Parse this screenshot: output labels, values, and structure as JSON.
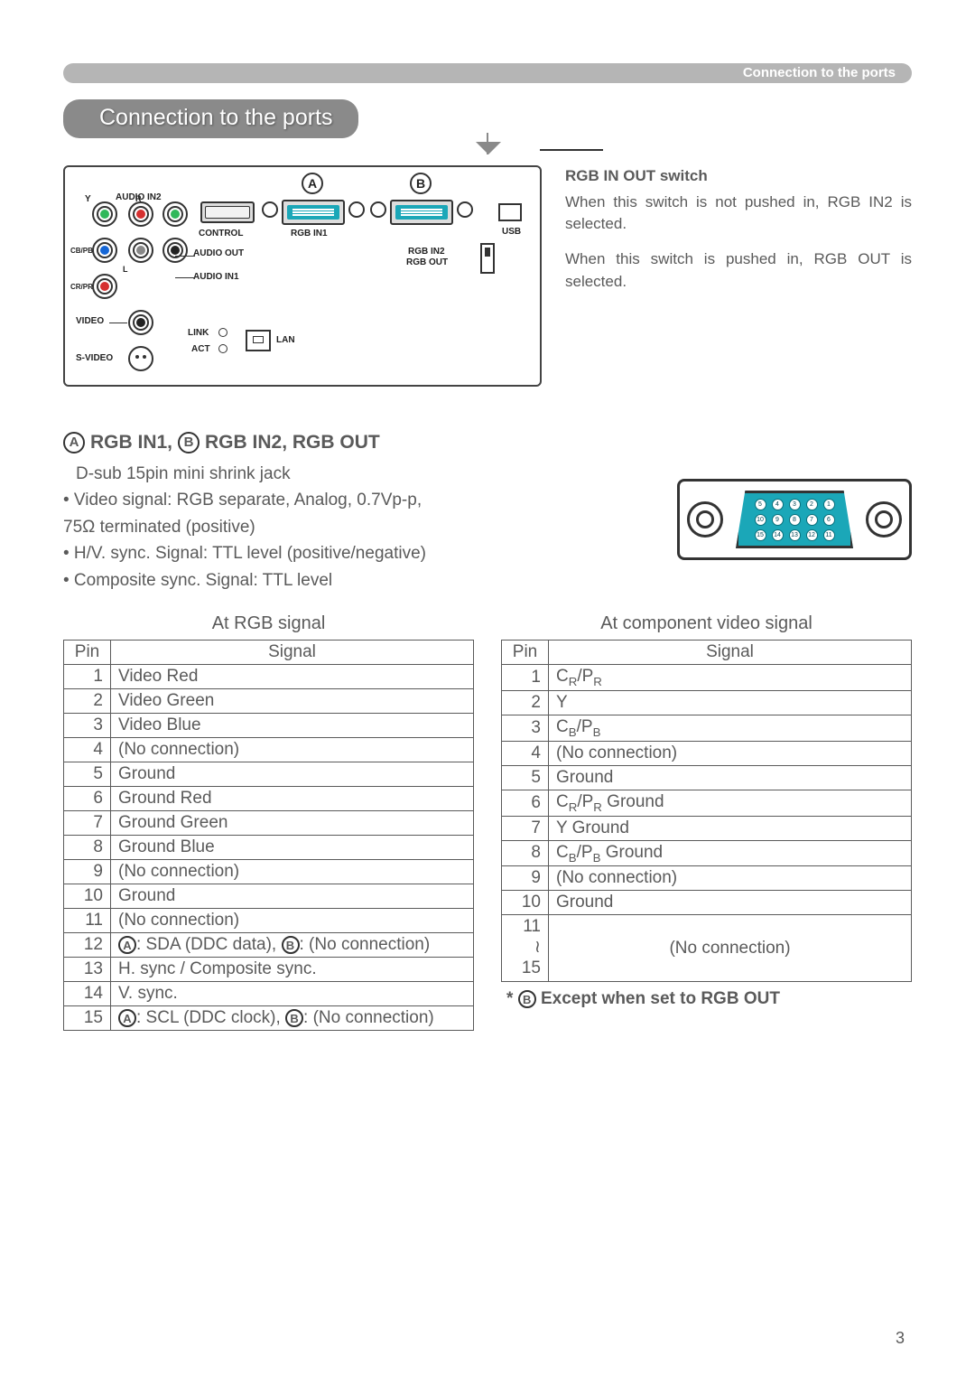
{
  "header": {
    "right_label": "Connection to the ports"
  },
  "title": "Connection to the ports",
  "diagram_labels": {
    "audio_in2": "AUDIO IN2",
    "y": "Y",
    "r": "R",
    "cb_pb": "CB/PB",
    "l": "L",
    "cr_pr": "CR/PR",
    "video": "VIDEO",
    "svideo": "S-VIDEO",
    "audio_out": "AUDIO OUT",
    "audio_in1": "AUDIO IN1",
    "control": "CONTROL",
    "rgb_in1": "RGB IN1",
    "rgb_in2": "RGB IN2",
    "rgb_out": "RGB OUT",
    "usb": "USB",
    "lan": "LAN",
    "link": "LINK",
    "act": "ACT",
    "callout_a": "A",
    "callout_b": "B"
  },
  "switch_text": {
    "title": "RGB IN OUT switch",
    "p1": "When this switch is not pushed in, RGB IN2 is selected.",
    "p2": "When this switch is pushed in, RGB OUT is selected."
  },
  "section_head": {
    "a": "A",
    "label_a": "RGB IN1,",
    "b": "B",
    "label_b": "RGB IN2, RGB OUT"
  },
  "specs": {
    "l1": "D-sub 15pin mini shrink jack",
    "l2": "• Video signal: RGB separate, Analog, 0.7Vp-p,",
    "l3": "75Ω terminated (positive)",
    "l4": "• H/V. sync. Signal: TTL level (positive/negative)",
    "l5": "• Composite sync. Signal: TTL level"
  },
  "tables": {
    "rgb": {
      "caption": "At RGB signal",
      "col1": "Pin",
      "col2": "Signal",
      "rows": [
        {
          "pin": "1",
          "signal": "Video Red"
        },
        {
          "pin": "2",
          "signal": "Video Green"
        },
        {
          "pin": "3",
          "signal": "Video Blue"
        },
        {
          "pin": "4",
          "signal": "(No connection)"
        },
        {
          "pin": "5",
          "signal": "Ground"
        },
        {
          "pin": "6",
          "signal": "Ground Red"
        },
        {
          "pin": "7",
          "signal": "Ground Green"
        },
        {
          "pin": "8",
          "signal": "Ground Blue"
        },
        {
          "pin": "9",
          "signal": "(No connection)"
        },
        {
          "pin": "10",
          "signal": "Ground"
        },
        {
          "pin": "11",
          "signal": "(No connection)"
        },
        {
          "pin": "12",
          "signal_pre": ": SDA (DDC data), ",
          "signal_post": ": (No connection)",
          "has_ab": true
        },
        {
          "pin": "13",
          "signal": "H. sync / Composite sync."
        },
        {
          "pin": "14",
          "signal": "V. sync."
        },
        {
          "pin": "15",
          "signal_pre": ": SCL (DDC clock), ",
          "signal_post": ": (No connection)",
          "has_ab": true
        }
      ]
    },
    "component": {
      "caption": "At component video signal",
      "col1": "Pin",
      "col2": "Signal",
      "rows": [
        {
          "pin": "1",
          "signal_html": "crpr"
        },
        {
          "pin": "2",
          "signal": "Y"
        },
        {
          "pin": "3",
          "signal_html": "cbpb"
        },
        {
          "pin": "4",
          "signal": "(No connection)"
        },
        {
          "pin": "5",
          "signal": "Ground"
        },
        {
          "pin": "6",
          "signal_html": "crpr_ground"
        },
        {
          "pin": "7",
          "signal": "Y Ground"
        },
        {
          "pin": "8",
          "signal_html": "cbpb_ground"
        },
        {
          "pin": "9",
          "signal": "(No connection)"
        },
        {
          "pin": "10",
          "signal": "Ground"
        }
      ],
      "nc_pins": "11",
      "nc_pins2": "15",
      "nc_label": "(No connection)"
    }
  },
  "footnote": {
    "star": "* ",
    "b": "B",
    "text": " Except when set to RGB OUT"
  },
  "labels_math": {
    "crpr": "CR/PR",
    "cbpb": "CB/PB",
    "crpr_ground": "CR/PR Ground",
    "cbpb_ground": "CB/PB Ground"
  },
  "vga_pins": [
    "5",
    "4",
    "3",
    "2",
    "1",
    "10",
    "9",
    "8",
    "7",
    "6",
    "15",
    "14",
    "13",
    "12",
    "11"
  ],
  "page_number": "3",
  "circled_a": "A",
  "circled_b": "B"
}
